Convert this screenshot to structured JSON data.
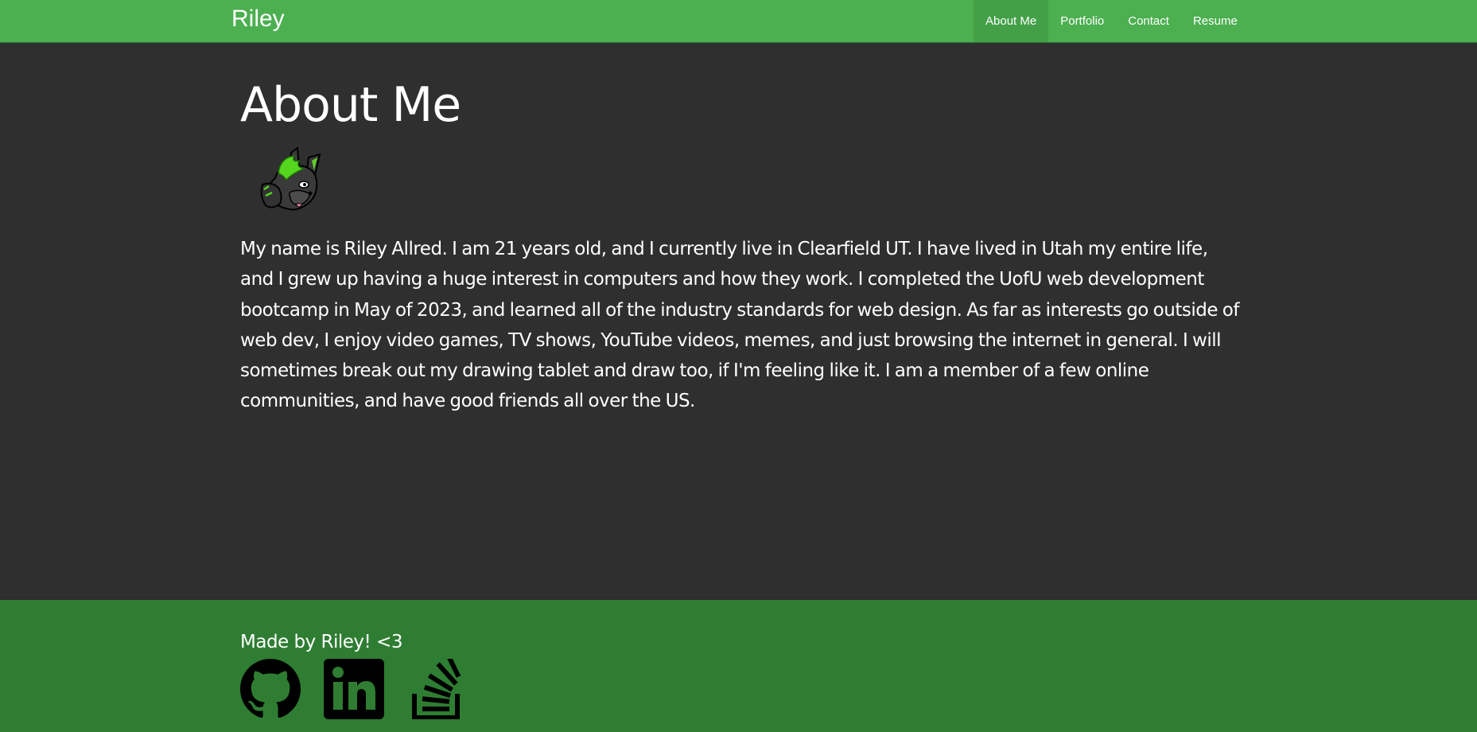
{
  "navbar": {
    "brand": "Riley",
    "links": [
      {
        "label": "About Me",
        "active": true
      },
      {
        "label": "Portfolio",
        "active": false
      },
      {
        "label": "Contact",
        "active": false
      },
      {
        "label": "Resume",
        "active": false
      }
    ]
  },
  "main": {
    "title": "About Me",
    "avatar_icon": "wolf-avatar",
    "bio": "My name is Riley Allred. I am 21 years old, and I currently live in Clearfield UT. I have lived in Utah my entire life, and I grew up having a huge interest in computers and how they work. I completed the UofU web development bootcamp in May of 2023, and learned all of the industry standards for web design. As far as interests go outside of web dev, I enjoy video games, TV shows, YouTube videos, memes, and just browsing the internet in general. I will sometimes break out my drawing tablet and draw too, if I'm feeling like it. I am a member of a few online communities, and have good friends all over the US."
  },
  "footer": {
    "text": "Made by Riley! <3",
    "social_icons": [
      "github-icon",
      "linkedin-icon",
      "stackoverflow-icon"
    ]
  },
  "colors": {
    "navbar": "#4caf50",
    "nav_active": "#43a047",
    "background": "#2f2f2f",
    "footer": "#2e7d32"
  }
}
